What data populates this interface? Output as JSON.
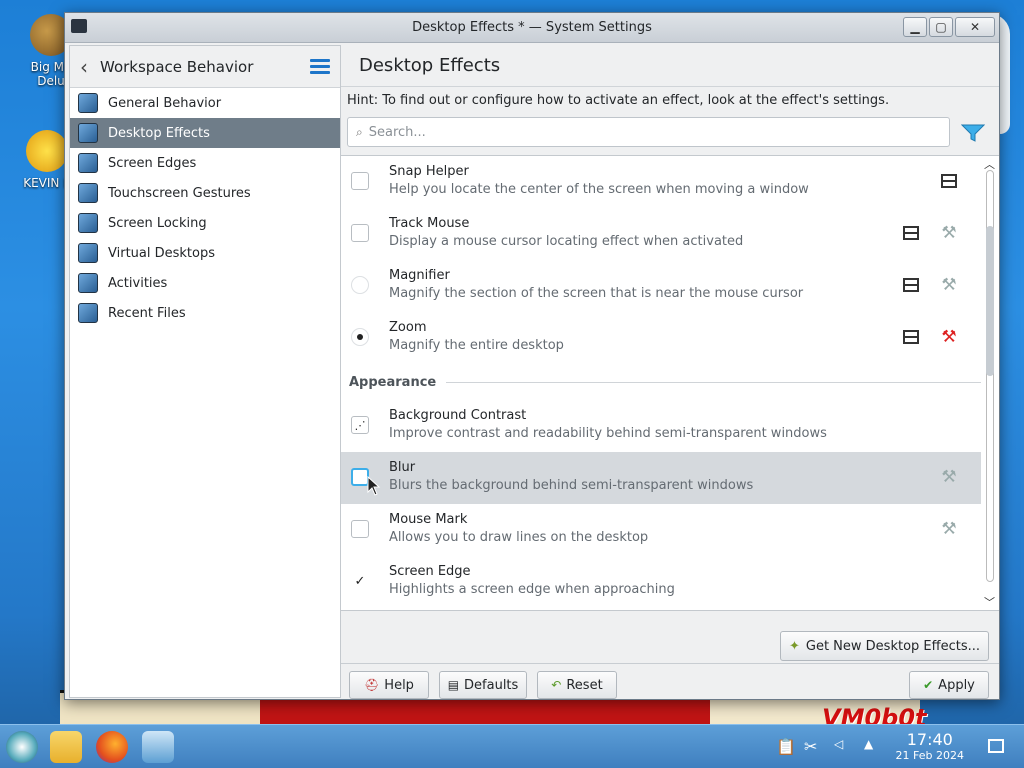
{
  "window": {
    "title": "Desktop Effects * — System Settings"
  },
  "desktop": {
    "icons": [
      {
        "label": "Big Mo Delu"
      },
      {
        "label": "KEVIN E"
      }
    ],
    "watermark": "VM0b0t"
  },
  "sidebar": {
    "header": "Workspace Behavior",
    "items": [
      {
        "label": "General Behavior"
      },
      {
        "label": "Desktop Effects",
        "active": true
      },
      {
        "label": "Screen Edges"
      },
      {
        "label": "Touchscreen Gestures"
      },
      {
        "label": "Screen Locking"
      },
      {
        "label": "Virtual Desktops"
      },
      {
        "label": "Activities"
      },
      {
        "label": "Recent Files"
      }
    ]
  },
  "main": {
    "title": "Desktop Effects",
    "hint": "Hint: To find out or configure how to activate an effect, look at the effect's settings.",
    "search": {
      "placeholder": "Search...",
      "value": ""
    },
    "effects": [
      {
        "name": "Snap Helper",
        "desc": "Help you locate the center of the screen when moving a window",
        "state": "unchecked"
      },
      {
        "name": "Track Mouse",
        "desc": "Display a mouse cursor locating effect when activated",
        "state": "unchecked"
      },
      {
        "name": "Magnifier",
        "desc": "Magnify the section of the screen that is near the mouse cursor",
        "state": "radio-off"
      },
      {
        "name": "Zoom",
        "desc": "Magnify the entire desktop",
        "state": "radio-on"
      }
    ],
    "section": "Appearance",
    "effects2": [
      {
        "name": "Background Contrast",
        "desc": "Improve contrast and readability behind semi-transparent windows",
        "state": "partial"
      },
      {
        "name": "Blur",
        "desc": "Blurs the background behind semi-transparent windows",
        "state": "unchecked"
      },
      {
        "name": "Mouse Mark",
        "desc": "Allows you to draw lines on the desktop",
        "state": "unchecked"
      },
      {
        "name": "Screen Edge",
        "desc": "Highlights a screen edge when approaching",
        "state": "checked"
      }
    ],
    "get_new": "Get New Desktop Effects...",
    "buttons": {
      "help": "Help",
      "defaults": "Defaults",
      "reset": "Reset",
      "apply": "Apply"
    }
  },
  "taskbar": {
    "time": "17:40",
    "date": "21 Feb 2024"
  },
  "colors": {
    "accent": "#3daee9",
    "selection": "#6f7d89",
    "hover": "#d5d9dd"
  }
}
